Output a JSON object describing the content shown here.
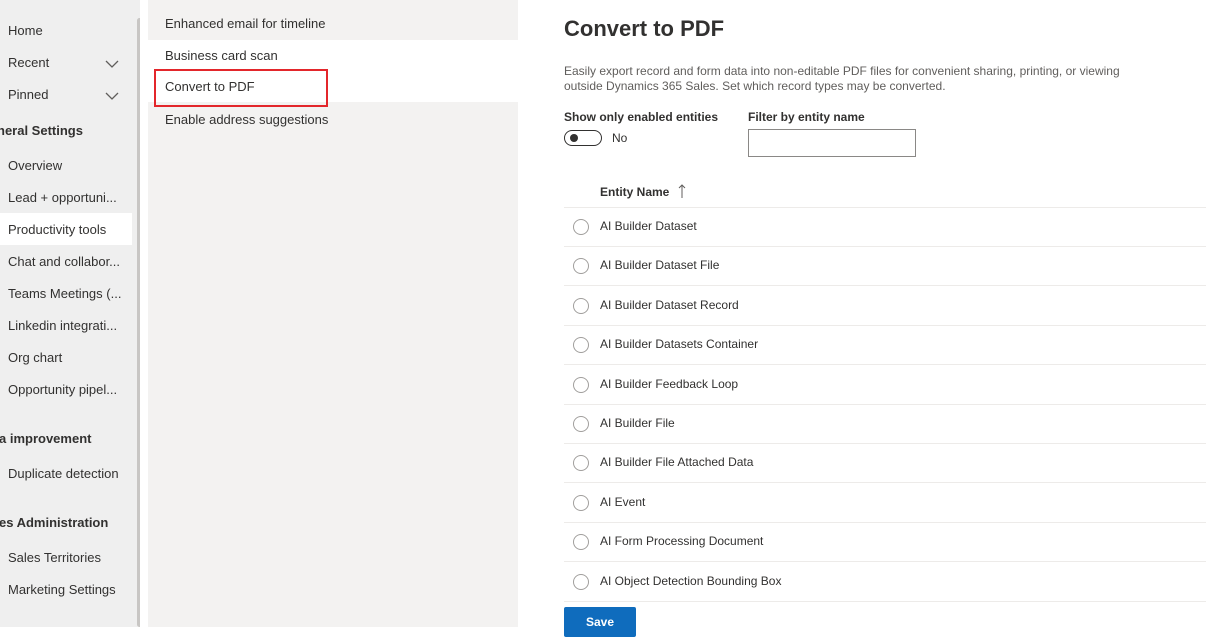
{
  "nav": {
    "items": [
      {
        "label": "Home"
      },
      {
        "label": "Recent"
      },
      {
        "label": "Pinned"
      }
    ],
    "sections": [
      {
        "title": "neral Settings",
        "items": [
          "Overview",
          "Lead + opportuni...",
          "Productivity tools",
          "Chat and collabor...",
          "Teams Meetings (...",
          "Linkedin integrati...",
          "Org chart",
          "Opportunity pipel..."
        ],
        "selected": "Productivity tools"
      },
      {
        "title": "a improvement",
        "items": [
          "Duplicate detection"
        ]
      },
      {
        "title": "es Administration",
        "items": [
          "Sales Territories",
          "Marketing Settings"
        ]
      }
    ]
  },
  "submenu": {
    "items": [
      "Enhanced email for timeline",
      "Business card scan",
      "Convert to PDF",
      "Enable address suggestions"
    ],
    "active": "Convert to PDF"
  },
  "main": {
    "title": "Convert to PDF",
    "description": "Easily export record and form data into non-editable PDF files for convenient sharing, printing, or viewing outside Dynamics 365 Sales. Set which record types may be converted.",
    "toggle_label": "Show only enabled entities",
    "toggle_state": "No",
    "filter_label": "Filter by entity name",
    "filter_value": "",
    "column_header": "Entity Name",
    "sort_icon": "arrow-up-icon",
    "rows": [
      "AI Builder Dataset",
      "AI Builder Dataset File",
      "AI Builder Dataset Record",
      "AI Builder Datasets Container",
      "AI Builder Feedback Loop",
      "AI Builder File",
      "AI Builder File Attached Data",
      "AI Event",
      "AI Form Processing Document",
      "AI Object Detection Bounding Box"
    ],
    "save_label": "Save"
  },
  "colors": {
    "accent": "#0f6cbd",
    "highlight": "#e3262b"
  }
}
